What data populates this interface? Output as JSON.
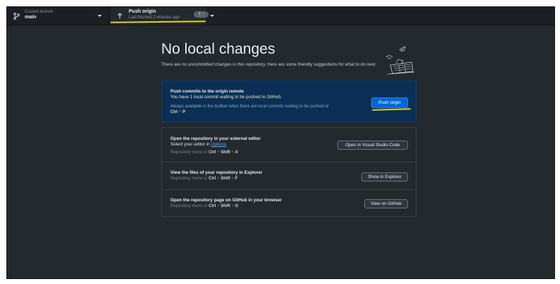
{
  "toolbar": {
    "branch": {
      "caption": "Current branch",
      "name": "main",
      "icon": "git-branch-icon"
    },
    "push": {
      "title": "Push origin",
      "subtitle": "Last fetched 2 minutes ago",
      "count": "1",
      "icon": "arrow-up-icon"
    }
  },
  "main": {
    "title": "No local changes",
    "subtitle": "There are no uncommitted changes in this repository. Here are some friendly suggestions for what to do next.",
    "push_card": {
      "title": "Push commits to the origin remote",
      "text": "You have 1 local commit waiting to be pushed to GitHub.",
      "hint_line1": "Always available in the toolbar when there are local commits waiting to be pushed or",
      "hint_key1": "Ctrl",
      "hint_key2": "P",
      "button": "Push origin"
    },
    "editor_card": {
      "title": "Open the repository in your external editor",
      "text_prefix": "Select your editor in",
      "link": "Options",
      "hint_prefix": "Repository menu or",
      "keys": [
        "Ctrl",
        "Shift",
        "A"
      ],
      "button": "Open in Visual Studio Code"
    },
    "explorer_card": {
      "title": "View the files of your repository in Explorer",
      "hint_prefix": "Repository menu or",
      "keys": [
        "Ctrl",
        "Shift",
        "F"
      ],
      "button": "Show in Explorer"
    },
    "github_card": {
      "title": "Open the repository page on GitHub in your browser",
      "hint_prefix": "Repository menu or",
      "keys": [
        "Ctrl",
        "Shift",
        "G"
      ],
      "button": "View on GitHub"
    }
  },
  "colors": {
    "background": "#24292e",
    "toolbar": "#1c1f23",
    "primary_card": "#0b2f54",
    "primary_button": "#0366d6",
    "highlight_annotation": "#e6d219"
  }
}
